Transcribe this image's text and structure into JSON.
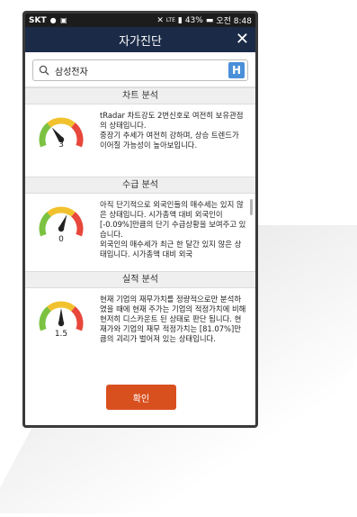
{
  "status_bar": {
    "carrier": "SKT",
    "battery": "43%",
    "time": "오전 8:48"
  },
  "dialog": {
    "title": "자가진단",
    "close_symbol": "✕"
  },
  "search": {
    "value": "삼성전자",
    "h_label": "H"
  },
  "sections": [
    {
      "header": "차트 분석",
      "gauge_value": "3",
      "needle_level": 0.33,
      "text": "tRadar 차트강도 2번신호로 여전히 보유관점의 상태입니다.\n중장기 추세가 여전히 강하며, 상승 트렌드가 이어질 가능성이 높아보입니다."
    },
    {
      "header": "수급 분석",
      "gauge_value": "0",
      "needle_level": 0.6,
      "text": "아직 단기적으로 외국인들의 매수세는 있지 않은 상태입니다. 시가총액 대비 외국인이 [-0.09%]만큼의 단기 수급상황을 보여주고 있습니다.\n외국인의 매수세가 최근 한 달간 있지 않은 상태입니다. 시가총액 대비 외국"
    },
    {
      "header": "실적 분석",
      "gauge_value": "1.5",
      "needle_level": 0.5,
      "text": "현재 기업의 재무가치를 정량적으로만 분석하였을 때에 현재 주가는 기업의 적정가치에 비해 현저히 디스카운트 된 상태로 판단 됩니다. 현재가와 기업의 재무 적정가치는 [81.07%]만큼의 괴리가 벌어져 있는 상태입니다."
    }
  ],
  "confirm_label": "확인",
  "colors": {
    "titlebar": "#1b2b47",
    "confirm": "#d9501f",
    "h_button": "#4a90d9",
    "gauge_green": "#7cc242",
    "gauge_yellow": "#f2c22e",
    "gauge_red": "#e8473b"
  }
}
